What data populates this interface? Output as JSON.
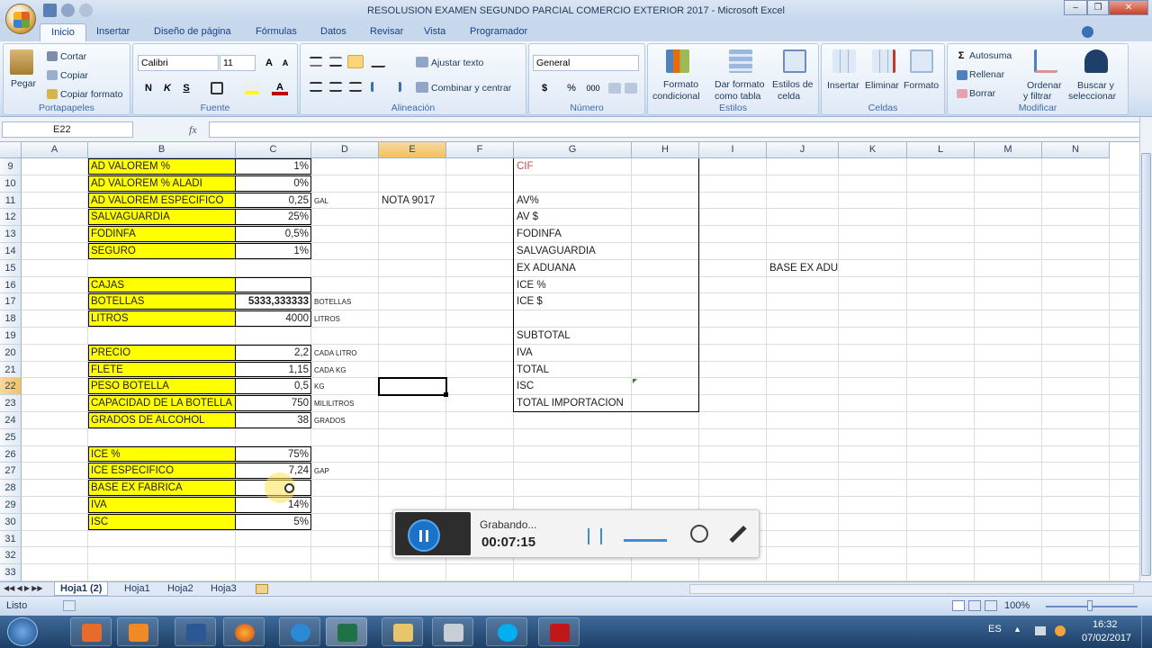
{
  "window": {
    "title": "RESOLUSION EXAMEN SEGUNDO PARCIAL COMERCIO EXTERIOR 2017 - Microsoft Excel"
  },
  "tabs": [
    "Inicio",
    "Insertar",
    "Diseño de página",
    "Fórmulas",
    "Datos",
    "Revisar",
    "Vista",
    "Programador"
  ],
  "ribbon": {
    "clipboard": {
      "paste": "Pegar",
      "cut": "Cortar",
      "copy": "Copiar",
      "format_painter": "Copiar formato",
      "label": "Portapapeles"
    },
    "font": {
      "name": "Calibri",
      "size": "11",
      "bold": "N",
      "italic": "K",
      "underline": "S",
      "label": "Fuente"
    },
    "alignment": {
      "wrap": "Ajustar texto",
      "merge": "Combinar y centrar",
      "label": "Alineación"
    },
    "number": {
      "format": "General",
      "currency": "$",
      "percent": "%",
      "thousands": "000",
      "label": "Número"
    },
    "styles": {
      "conditional": [
        "Formato",
        "condicional"
      ],
      "table": [
        "Dar formato",
        "como tabla"
      ],
      "cell": [
        "Estilos de",
        "celda"
      ],
      "label": "Estilos"
    },
    "cells": {
      "insert": "Insertar",
      "delete": "Eliminar",
      "format": "Formato",
      "label": "Celdas"
    },
    "editing": {
      "autosum": "Autosuma",
      "fill": "Rellenar",
      "clear": "Borrar",
      "sort": [
        "Ordenar",
        "y filtrar"
      ],
      "find": [
        "Buscar y",
        "seleccionar"
      ],
      "label": "Modificar"
    }
  },
  "formula_bar": {
    "name_box": "E22",
    "fx": "fx",
    "content": ""
  },
  "columns": [
    "A",
    "B",
    "C",
    "D",
    "E",
    "F",
    "G",
    "H",
    "I",
    "J",
    "K",
    "L",
    "M",
    "N"
  ],
  "rows": [
    "9",
    "10",
    "11",
    "12",
    "13",
    "14",
    "15",
    "16",
    "17",
    "18",
    "19",
    "20",
    "21",
    "22",
    "23",
    "24",
    "25",
    "26",
    "27",
    "28",
    "29",
    "30",
    "31",
    "32",
    "33"
  ],
  "cells": {
    "B": {
      "9": "AD VALOREM %",
      "10": "AD VALOREM % ALADI",
      "11": "AD VALOREM ESPECIFICO",
      "12": "SALVAGUARDIA",
      "13": "FODINFA",
      "14": "SEGURO",
      "16": "CAJAS",
      "17": "BOTELLAS",
      "18": "LITROS",
      "20": "PRECIO",
      "21": "FLETE",
      "22": "PESO BOTELLA",
      "23": "CAPACIDAD DE LA BOTELLA",
      "24": "GRADOS DE ALCOHOL",
      "26": "ICE %",
      "27": "ICE ESPECIFICO",
      "28": "BASE EX FABRICA",
      "29": "IVA",
      "30": "ISC"
    },
    "C": {
      "9": "1%",
      "10": "0%",
      "11": "0,25",
      "12": "25%",
      "13": "0,5%",
      "14": "1%",
      "17": "5333,333333",
      "18": "4000",
      "20": "2,2",
      "21": "1,15",
      "22": "0,5",
      "23": "750",
      "24": "38",
      "26": "75%",
      "27": "7,24",
      "29": "14%",
      "30": "5%"
    },
    "D": {
      "11": "GAL",
      "17": "BOTELLAS",
      "18": "LITROS",
      "20": "CADA LITRO",
      "21": "CADA KG",
      "22": "KG",
      "23": "MILILITROS",
      "24": "GRADOS",
      "27": "GAP"
    },
    "E": {
      "11": "NOTA 9017"
    },
    "G": {
      "9": "CIF",
      "11": "AV%",
      "12": "AV $",
      "13": "FODINFA",
      "14": "SALVAGUARDIA",
      "15": "EX ADUANA",
      "16": "ICE %",
      "17": "ICE $",
      "19": "SUBTOTAL",
      "20": "IVA",
      "21": "TOTAL",
      "22": "ISC",
      "23": "TOTAL IMPORTACION"
    },
    "J": {
      "15": "BASE EX ADU"
    }
  },
  "sheets": [
    "Hoja1 (2)",
    "Hoja1",
    "Hoja2",
    "Hoja3"
  ],
  "status": {
    "mode": "Listo",
    "zoom": "100%"
  },
  "recorder": {
    "status": "Grabando...",
    "time": "00:07:15"
  },
  "taskbar": {
    "lang": "ES",
    "time": "16:32",
    "date": "07/02/2017"
  },
  "colors": {
    "yellow": "#ffff00",
    "cif_red": "#c0504d",
    "ribbon_blue": "#15428b"
  }
}
